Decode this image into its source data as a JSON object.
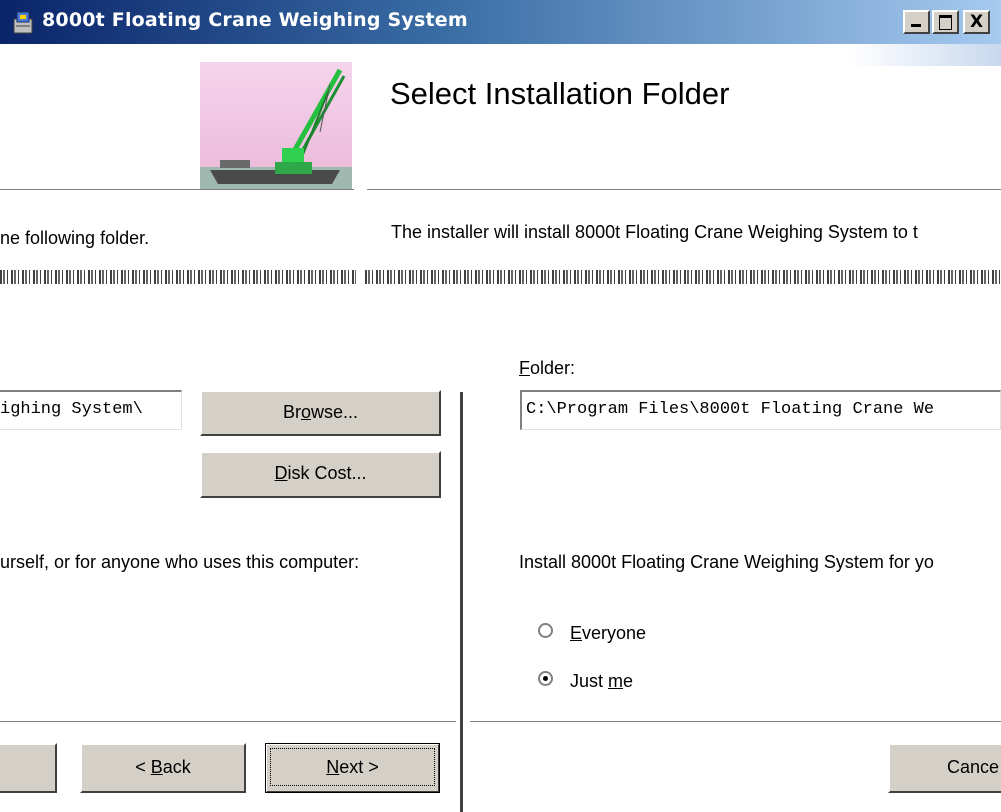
{
  "window": {
    "title": "8000t Floating Crane Weighing System",
    "controls": {
      "minimize": "_",
      "maximize": "□",
      "close": "X"
    }
  },
  "header": {
    "heading": "Select Installation Folder"
  },
  "instructions": {
    "left_fragment": "ne following folder.",
    "right_fragment": "The installer will install 8000t Floating Crane Weighing System to t"
  },
  "folder": {
    "label_prefix": "",
    "label_accel": "F",
    "label_rest": "older:",
    "value_right": "C:\\Program Files\\8000t Floating Crane We",
    "value_left": "ighing System\\"
  },
  "buttons": {
    "browse_pre": "Br",
    "browse_accel": "o",
    "browse_post": "wse...",
    "disk_cost_pre": "",
    "disk_cost_accel": "D",
    "disk_cost_post": "isk Cost...",
    "back_pre": "< ",
    "back_accel": "B",
    "back_post": "ack",
    "next_pre": "",
    "next_accel": "N",
    "next_post": "ext >",
    "cancel": "Cance"
  },
  "install_for": {
    "left_fragment": "urself, or for anyone who uses this computer:",
    "right_fragment": "Install 8000t Floating Crane Weighing System for yo",
    "options": [
      {
        "pre": "",
        "accel": "E",
        "post": "veryone",
        "selected": false
      },
      {
        "pre": "Just ",
        "accel": "m",
        "post": "e",
        "selected": true
      }
    ]
  },
  "colors": {
    "titlebar_start": "#0a246a",
    "titlebar_end": "#a6caf0",
    "button_face": "#d4d0c8"
  }
}
